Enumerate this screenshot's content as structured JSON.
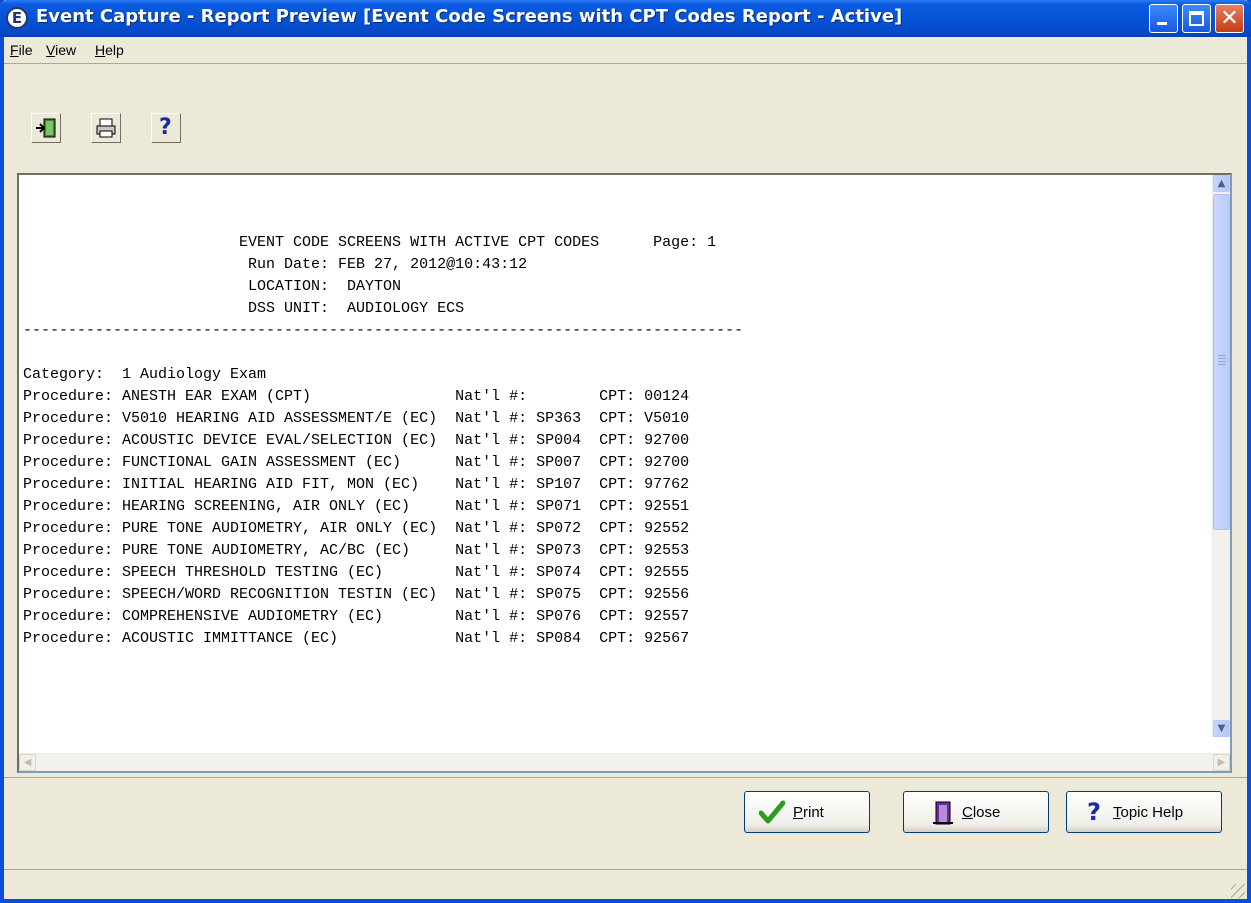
{
  "window": {
    "title": "Event Capture - Report Preview [Event Code Screens with CPT Codes Report - Active]",
    "app_icon_letter": "E"
  },
  "menu": {
    "file": {
      "key": "F",
      "rest": "ile"
    },
    "view": {
      "key": "V",
      "rest": "iew"
    },
    "help": {
      "key": "H",
      "rest": "elp"
    }
  },
  "toolbar": {
    "exit_icon": "exit-door-icon",
    "print_icon": "printer-icon",
    "help_icon": "question-mark-icon",
    "help_glyph": "?"
  },
  "report": {
    "header": [
      "                        EVENT CODE SCREENS WITH ACTIVE CPT CODES      Page: 1",
      "                         Run Date: FEB 27, 2012@10:43:12",
      "                         LOCATION:  DAYTON",
      "                         DSS UNIT:  AUDIOLOGY ECS",
      "--------------------------------------------------------------------------------"
    ],
    "blank": " ",
    "category": "Category:  1 Audiology Exam",
    "rows": [
      "Procedure: ANESTH EAR EXAM (CPT)                Nat'l #:        CPT: 00124",
      "Procedure: V5010 HEARING AID ASSESSMENT/E (EC)  Nat'l #: SP363  CPT: V5010",
      "Procedure: ACOUSTIC DEVICE EVAL/SELECTION (EC)  Nat'l #: SP004  CPT: 92700",
      "Procedure: FUNCTIONAL GAIN ASSESSMENT (EC)      Nat'l #: SP007  CPT: 92700",
      "Procedure: INITIAL HEARING AID FIT, MON (EC)    Nat'l #: SP107  CPT: 97762",
      "Procedure: HEARING SCREENING, AIR ONLY (EC)     Nat'l #: SP071  CPT: 92551",
      "Procedure: PURE TONE AUDIOMETRY, AIR ONLY (EC)  Nat'l #: SP072  CPT: 92552",
      "Procedure: PURE TONE AUDIOMETRY, AC/BC (EC)     Nat'l #: SP073  CPT: 92553",
      "Procedure: SPEECH THRESHOLD TESTING (EC)        Nat'l #: SP074  CPT: 92555",
      "Procedure: SPEECH/WORD RECOGNITION TESTIN (EC)  Nat'l #: SP075  CPT: 92556",
      "Procedure: COMPREHENSIVE AUDIOMETRY (EC)        Nat'l #: SP076  CPT: 92557",
      "Procedure: ACOUSTIC IMMITTANCE (EC)             Nat'l #: SP084  CPT: 92567"
    ]
  },
  "buttons": {
    "print": {
      "key": "P",
      "rest": "rint",
      "icon": "checkmark-icon"
    },
    "close": {
      "key": "C",
      "rest": "lose",
      "icon": "exit-door-icon"
    },
    "topic_help": {
      "key": "T",
      "rest": "opic Help",
      "icon": "question-mark-icon",
      "glyph": "?"
    }
  },
  "colors": {
    "title_bar": "#0653D6",
    "face": "#ECE9D8",
    "check_green": "#2E9B1E",
    "help_blue": "#1A2BA8"
  }
}
